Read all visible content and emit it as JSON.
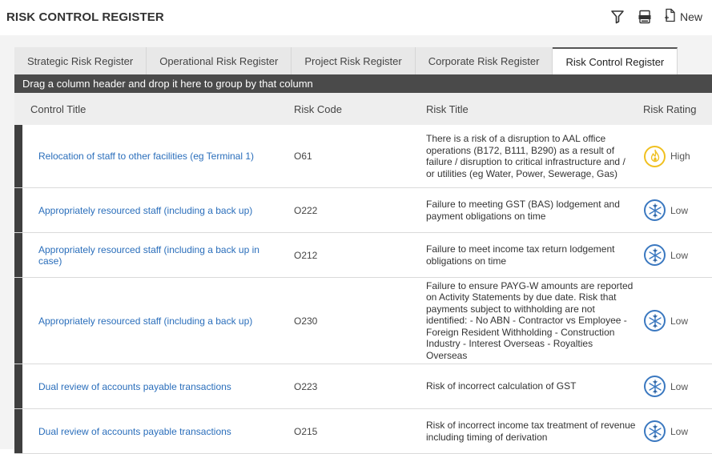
{
  "header": {
    "title": "RISK CONTROL REGISTER",
    "new_label": "New",
    "icons": [
      "filter-icon",
      "export-xlsx-icon",
      "new-document-icon"
    ]
  },
  "tabs": [
    {
      "label": "Strategic Risk Register",
      "active": false
    },
    {
      "label": "Operational Risk Register",
      "active": false
    },
    {
      "label": "Project Risk Register",
      "active": false
    },
    {
      "label": "Corporate Risk Register",
      "active": false
    },
    {
      "label": "Risk Control Register",
      "active": true
    }
  ],
  "group_hint": "Drag a column header and drop it here to group by that column",
  "columns": {
    "control_title": "Control Title",
    "risk_code": "Risk Code",
    "risk_title": "Risk Title",
    "risk_rating": "Risk Rating"
  },
  "rows": [
    {
      "control_title": "Relocation of staff to other facilities (eg Terminal 1)",
      "risk_code": "O61",
      "risk_title": "There is a risk of a disruption to AAL office operations (B172, B111, B290) as a result of failure / disruption to critical infrastructure and / or utilities (eg Water, Power, Sewerage, Gas)",
      "rating": "High",
      "rating_icon": "fire-icon"
    },
    {
      "control_title": "Appropriately resourced staff (including a back up)",
      "risk_code": "O222",
      "risk_title": "Failure to meeting GST (BAS) lodgement and payment obligations on time",
      "rating": "Low",
      "rating_icon": "snowflake-icon"
    },
    {
      "control_title": "Appropriately resourced staff (including a back up in case)",
      "risk_code": "O212",
      "risk_title": "Failure to meet income tax return lodgement obligations on time",
      "rating": "Low",
      "rating_icon": "snowflake-icon"
    },
    {
      "control_title": "Appropriately resourced staff (including a back up)",
      "risk_code": "O230",
      "risk_title": "Failure to ensure PAYG-W amounts are reported on Activity Statements by due date. Risk that payments subject to withholding are not identified: - No ABN - Contractor vs Employee - Foreign Resident Withholding - Construction Industry - Interest Overseas - Royalties Overseas",
      "rating": "Low",
      "rating_icon": "snowflake-icon"
    },
    {
      "control_title": "Dual review of accounts payable transactions",
      "risk_code": "O223",
      "risk_title": "Risk of incorrect calculation of GST",
      "rating": "Low",
      "rating_icon": "snowflake-icon"
    },
    {
      "control_title": "Dual review of accounts payable transactions",
      "risk_code": "O215",
      "risk_title": "Risk of incorrect income tax treatment of revenue including timing of derivation",
      "rating": "Low",
      "rating_icon": "snowflake-icon"
    }
  ],
  "colors": {
    "accent_link": "#2a6ebb",
    "high": "#f0c020",
    "low": "#3a78c0",
    "group_bar": "#4a4a4a"
  }
}
